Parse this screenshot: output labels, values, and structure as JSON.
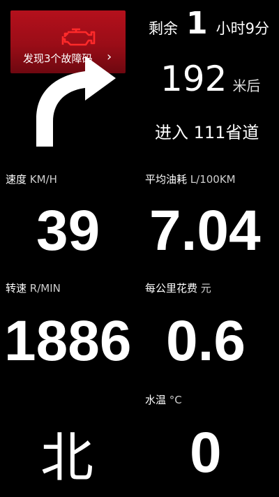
{
  "fault": {
    "text": "发现3个故障码",
    "chevron": "›",
    "icon": "engine-warning-icon",
    "icon_color": "#ff2a2a",
    "bg_color": "#a50e18"
  },
  "navigation": {
    "remaining_prefix": "剩余",
    "remaining_hours": "1",
    "remaining_rest": "小时9分",
    "distance_value": "192",
    "distance_unit": "米后",
    "road_name": "进入 111省道",
    "turn_icon": "turn-right-arrow-icon"
  },
  "metrics": {
    "speed": {
      "label": "速度",
      "unit": "KM/H",
      "value": "39"
    },
    "fuel": {
      "label": "平均油耗",
      "unit": "L/100KM",
      "value": "7.04"
    },
    "rpm": {
      "label": "转速",
      "unit": "R/MIN",
      "value": "1886"
    },
    "cost": {
      "label": "每公里花费",
      "unit": "元",
      "value": "0.6"
    },
    "temp": {
      "label": "水温",
      "unit": "°C",
      "value": "0"
    },
    "direction": "北"
  }
}
